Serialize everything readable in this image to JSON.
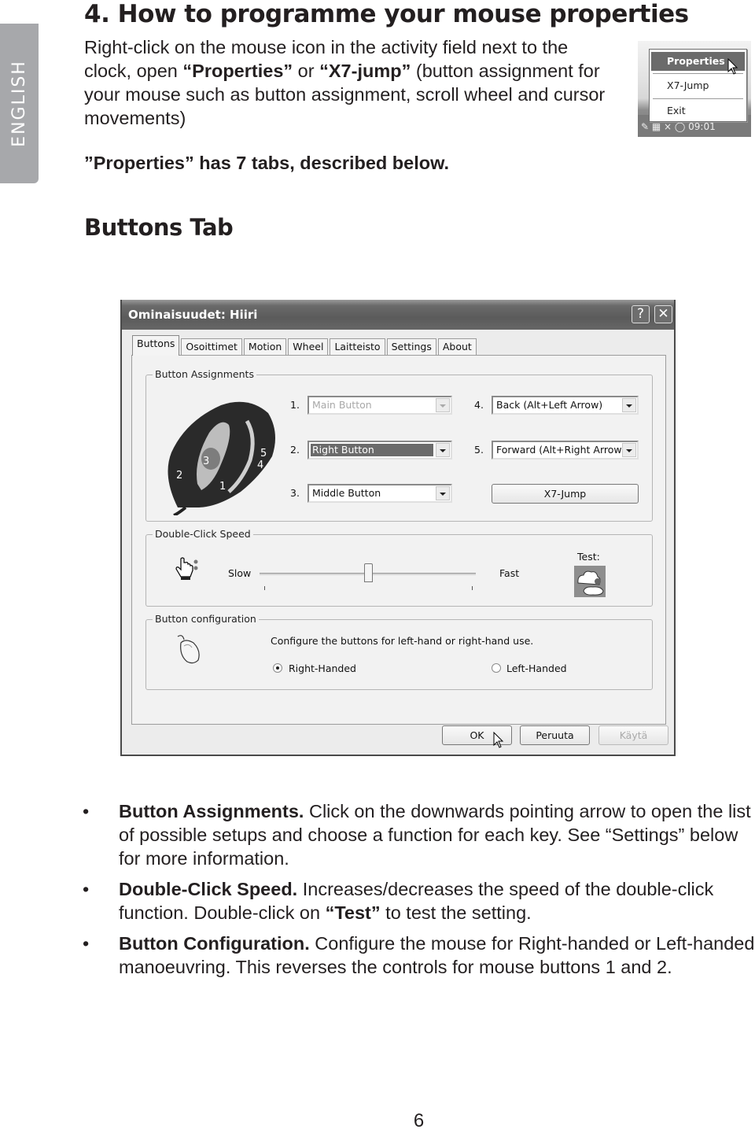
{
  "side_tab": {
    "label": "ENGLISH"
  },
  "heading": "4. How to programme your mouse properties",
  "intro": {
    "part1": "Right-click on the mouse icon in the activity field next to the clock, open ",
    "properties": "“Properties”",
    "or": " or ",
    "x7jump": "“X7-jump”",
    "part2": " (button assignment for your mouse such as button assignment, scroll wheel and cursor movements)"
  },
  "tabs_note": "”Properties” has 7 tabs, described below.",
  "section_title": "Buttons Tab",
  "context_menu": {
    "items": [
      {
        "label": "Properties",
        "highlighted": true
      },
      {
        "label": "X7-Jump",
        "highlighted": false
      },
      {
        "label": "Exit",
        "highlighted": false
      }
    ],
    "tray_clock": "09:01"
  },
  "dialog": {
    "title": "Ominaisuudet: Hiiri",
    "help_button": "?",
    "close_button": "✕",
    "tabs": [
      "Buttons",
      "Osoittimet",
      "Motion",
      "Wheel",
      "Laitteisto",
      "Settings",
      "About"
    ],
    "active_tab": "Buttons",
    "button_assignments": {
      "label": "Button Assignments",
      "mouse_labels": [
        "1",
        "2",
        "3",
        "4",
        "5"
      ],
      "rows": [
        {
          "num": "1.",
          "value": "Main Button",
          "state": "disabled"
        },
        {
          "num": "2.",
          "value": "Right Button",
          "state": "selected"
        },
        {
          "num": "3.",
          "value": "Middle Button",
          "state": "normal"
        },
        {
          "num": "4.",
          "value": "Back (Alt+Left Arrow)",
          "state": "normal"
        },
        {
          "num": "5.",
          "value": "Forward (Alt+Right Arrow)",
          "state": "normal"
        }
      ],
      "x7_jump_button": "X7-Jump"
    },
    "double_click": {
      "label": "Double-Click Speed",
      "slow": "Slow",
      "fast": "Fast",
      "test_label": "Test:",
      "slider_value_fraction": 0.5
    },
    "button_config": {
      "label": "Button configuration",
      "description": "Configure the buttons for left-hand or right-hand use.",
      "options": [
        {
          "label": "Right-Handed",
          "checked": true
        },
        {
          "label": "Left-Handed",
          "checked": false
        }
      ]
    },
    "footer": {
      "ok": "OK",
      "cancel": "Peruuta",
      "apply": "Käytä"
    }
  },
  "bullets": [
    {
      "title": "Button Assignments.",
      "text": "  Click on the downwards pointing arrow to open the list of possible setups and choose a function for each key. See “Settings” below for more information."
    },
    {
      "title": "Double-Click Speed.",
      "text": " Increases/decreases the speed of the double-click function. Double-click on ",
      "bold2": "“Test”",
      "text2": " to test the setting."
    },
    {
      "title": "Button Configuration.",
      "text": "  Configure the mouse for Right-handed or Left-handed manoeuvring. This reverses the controls for mouse buttons 1 and 2."
    }
  ],
  "bullet_char": "•",
  "page_number": "6"
}
